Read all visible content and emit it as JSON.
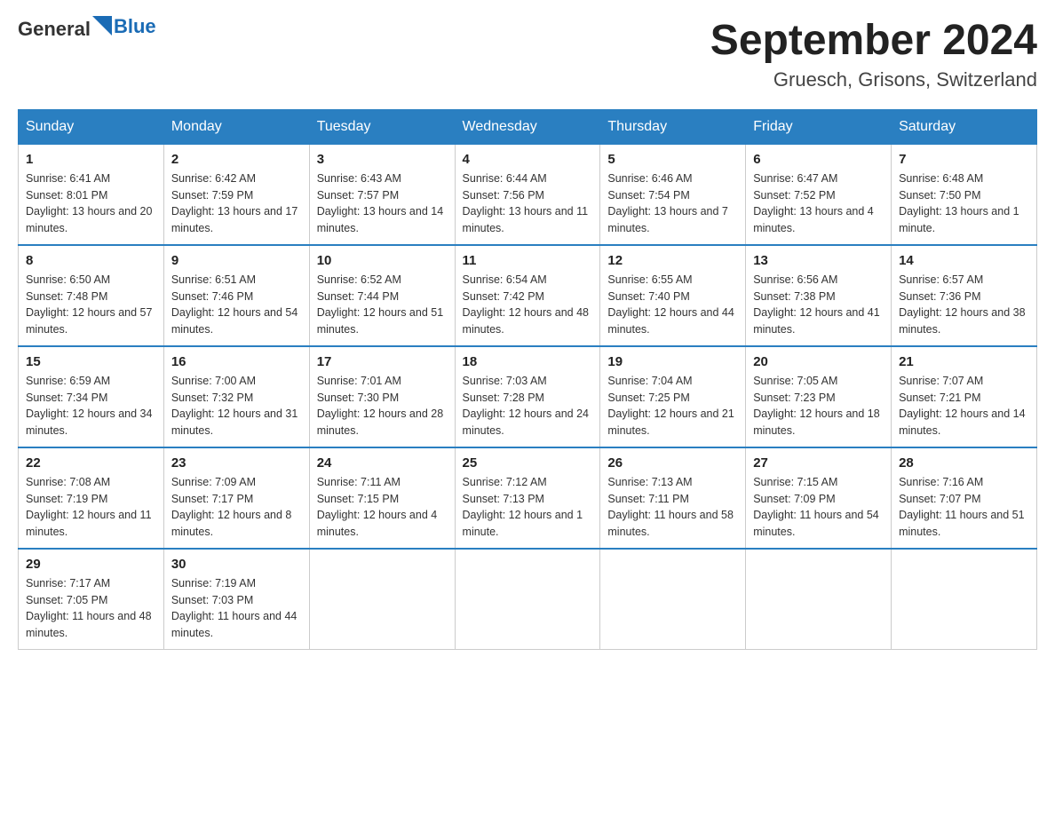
{
  "logo": {
    "text_general": "General",
    "text_blue": "Blue"
  },
  "title": "September 2024",
  "location": "Gruesch, Grisons, Switzerland",
  "days_of_week": [
    "Sunday",
    "Monday",
    "Tuesday",
    "Wednesday",
    "Thursday",
    "Friday",
    "Saturday"
  ],
  "weeks": [
    [
      {
        "day": "1",
        "sunrise": "Sunrise: 6:41 AM",
        "sunset": "Sunset: 8:01 PM",
        "daylight": "Daylight: 13 hours and 20 minutes."
      },
      {
        "day": "2",
        "sunrise": "Sunrise: 6:42 AM",
        "sunset": "Sunset: 7:59 PM",
        "daylight": "Daylight: 13 hours and 17 minutes."
      },
      {
        "day": "3",
        "sunrise": "Sunrise: 6:43 AM",
        "sunset": "Sunset: 7:57 PM",
        "daylight": "Daylight: 13 hours and 14 minutes."
      },
      {
        "day": "4",
        "sunrise": "Sunrise: 6:44 AM",
        "sunset": "Sunset: 7:56 PM",
        "daylight": "Daylight: 13 hours and 11 minutes."
      },
      {
        "day": "5",
        "sunrise": "Sunrise: 6:46 AM",
        "sunset": "Sunset: 7:54 PM",
        "daylight": "Daylight: 13 hours and 7 minutes."
      },
      {
        "day": "6",
        "sunrise": "Sunrise: 6:47 AM",
        "sunset": "Sunset: 7:52 PM",
        "daylight": "Daylight: 13 hours and 4 minutes."
      },
      {
        "day": "7",
        "sunrise": "Sunrise: 6:48 AM",
        "sunset": "Sunset: 7:50 PM",
        "daylight": "Daylight: 13 hours and 1 minute."
      }
    ],
    [
      {
        "day": "8",
        "sunrise": "Sunrise: 6:50 AM",
        "sunset": "Sunset: 7:48 PM",
        "daylight": "Daylight: 12 hours and 57 minutes."
      },
      {
        "day": "9",
        "sunrise": "Sunrise: 6:51 AM",
        "sunset": "Sunset: 7:46 PM",
        "daylight": "Daylight: 12 hours and 54 minutes."
      },
      {
        "day": "10",
        "sunrise": "Sunrise: 6:52 AM",
        "sunset": "Sunset: 7:44 PM",
        "daylight": "Daylight: 12 hours and 51 minutes."
      },
      {
        "day": "11",
        "sunrise": "Sunrise: 6:54 AM",
        "sunset": "Sunset: 7:42 PM",
        "daylight": "Daylight: 12 hours and 48 minutes."
      },
      {
        "day": "12",
        "sunrise": "Sunrise: 6:55 AM",
        "sunset": "Sunset: 7:40 PM",
        "daylight": "Daylight: 12 hours and 44 minutes."
      },
      {
        "day": "13",
        "sunrise": "Sunrise: 6:56 AM",
        "sunset": "Sunset: 7:38 PM",
        "daylight": "Daylight: 12 hours and 41 minutes."
      },
      {
        "day": "14",
        "sunrise": "Sunrise: 6:57 AM",
        "sunset": "Sunset: 7:36 PM",
        "daylight": "Daylight: 12 hours and 38 minutes."
      }
    ],
    [
      {
        "day": "15",
        "sunrise": "Sunrise: 6:59 AM",
        "sunset": "Sunset: 7:34 PM",
        "daylight": "Daylight: 12 hours and 34 minutes."
      },
      {
        "day": "16",
        "sunrise": "Sunrise: 7:00 AM",
        "sunset": "Sunset: 7:32 PM",
        "daylight": "Daylight: 12 hours and 31 minutes."
      },
      {
        "day": "17",
        "sunrise": "Sunrise: 7:01 AM",
        "sunset": "Sunset: 7:30 PM",
        "daylight": "Daylight: 12 hours and 28 minutes."
      },
      {
        "day": "18",
        "sunrise": "Sunrise: 7:03 AM",
        "sunset": "Sunset: 7:28 PM",
        "daylight": "Daylight: 12 hours and 24 minutes."
      },
      {
        "day": "19",
        "sunrise": "Sunrise: 7:04 AM",
        "sunset": "Sunset: 7:25 PM",
        "daylight": "Daylight: 12 hours and 21 minutes."
      },
      {
        "day": "20",
        "sunrise": "Sunrise: 7:05 AM",
        "sunset": "Sunset: 7:23 PM",
        "daylight": "Daylight: 12 hours and 18 minutes."
      },
      {
        "day": "21",
        "sunrise": "Sunrise: 7:07 AM",
        "sunset": "Sunset: 7:21 PM",
        "daylight": "Daylight: 12 hours and 14 minutes."
      }
    ],
    [
      {
        "day": "22",
        "sunrise": "Sunrise: 7:08 AM",
        "sunset": "Sunset: 7:19 PM",
        "daylight": "Daylight: 12 hours and 11 minutes."
      },
      {
        "day": "23",
        "sunrise": "Sunrise: 7:09 AM",
        "sunset": "Sunset: 7:17 PM",
        "daylight": "Daylight: 12 hours and 8 minutes."
      },
      {
        "day": "24",
        "sunrise": "Sunrise: 7:11 AM",
        "sunset": "Sunset: 7:15 PM",
        "daylight": "Daylight: 12 hours and 4 minutes."
      },
      {
        "day": "25",
        "sunrise": "Sunrise: 7:12 AM",
        "sunset": "Sunset: 7:13 PM",
        "daylight": "Daylight: 12 hours and 1 minute."
      },
      {
        "day": "26",
        "sunrise": "Sunrise: 7:13 AM",
        "sunset": "Sunset: 7:11 PM",
        "daylight": "Daylight: 11 hours and 58 minutes."
      },
      {
        "day": "27",
        "sunrise": "Sunrise: 7:15 AM",
        "sunset": "Sunset: 7:09 PM",
        "daylight": "Daylight: 11 hours and 54 minutes."
      },
      {
        "day": "28",
        "sunrise": "Sunrise: 7:16 AM",
        "sunset": "Sunset: 7:07 PM",
        "daylight": "Daylight: 11 hours and 51 minutes."
      }
    ],
    [
      {
        "day": "29",
        "sunrise": "Sunrise: 7:17 AM",
        "sunset": "Sunset: 7:05 PM",
        "daylight": "Daylight: 11 hours and 48 minutes."
      },
      {
        "day": "30",
        "sunrise": "Sunrise: 7:19 AM",
        "sunset": "Sunset: 7:03 PM",
        "daylight": "Daylight: 11 hours and 44 minutes."
      },
      null,
      null,
      null,
      null,
      null
    ]
  ]
}
